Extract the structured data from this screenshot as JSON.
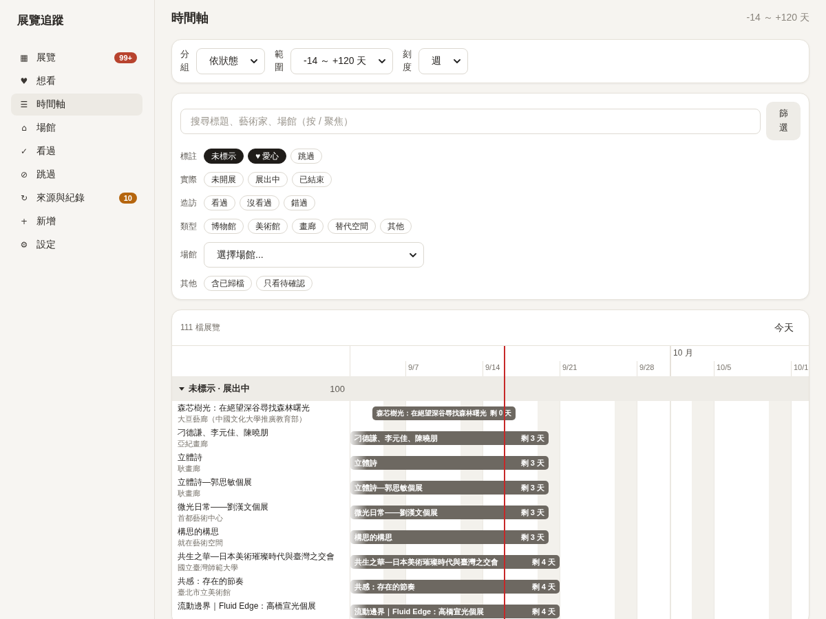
{
  "sidebar": {
    "title": "展覽追蹤",
    "items": [
      {
        "icon": "▦",
        "label": "展覽",
        "selected": false,
        "badge": {
          "text": "99+",
          "color": "#b8432e"
        }
      },
      {
        "icon": "♥",
        "label": "想看",
        "selected": false
      },
      {
        "icon": "☰",
        "label": "時間軸",
        "selected": true
      },
      {
        "icon": "⌂",
        "label": "場館",
        "selected": false
      },
      {
        "icon": "✓",
        "label": "看過",
        "selected": false
      },
      {
        "icon": "⊘",
        "label": "跳過",
        "selected": false
      },
      {
        "icon": "↻",
        "label": "來源與紀錄",
        "selected": false,
        "badge": {
          "text": "10",
          "color": "#b5650e"
        }
      },
      {
        "icon": "+",
        "label": "新增",
        "selected": false
      },
      {
        "icon": "⚙",
        "label": "設定",
        "selected": false
      }
    ]
  },
  "header": {
    "title": "時間軸",
    "range": "-14 ～ +120 天"
  },
  "view_controls": [
    {
      "label": "分組",
      "value": "依狀態"
    },
    {
      "label": "範圍",
      "value": "-14 ～ +120 天"
    },
    {
      "label": "刻度",
      "value": "週"
    }
  ],
  "filters": {
    "search": {
      "placeholder": "搜尋標題、藝術家、場館（按 / 聚焦）"
    },
    "filter_button": "篩選",
    "groups": [
      {
        "label": "標註",
        "kind": "chips",
        "chips": [
          {
            "label": "未標示",
            "selected": true
          },
          {
            "label": "♥ 愛心",
            "selected": true
          },
          {
            "label": "跳過",
            "selected": false
          }
        ]
      },
      {
        "label": "實際",
        "kind": "chips",
        "chips": [
          {
            "label": "未開展",
            "selected": false
          },
          {
            "label": "展出中",
            "selected": false
          },
          {
            "label": "已結束",
            "selected": false
          }
        ]
      },
      {
        "label": "造訪",
        "kind": "chips",
        "chips": [
          {
            "label": "看過",
            "selected": false
          },
          {
            "label": "沒看過",
            "selected": false
          },
          {
            "label": "錯過",
            "selected": false
          }
        ]
      },
      {
        "label": "類型",
        "kind": "chips",
        "chips": [
          {
            "label": "博物館",
            "selected": false
          },
          {
            "label": "美術館",
            "selected": false
          },
          {
            "label": "畫廊",
            "selected": false
          },
          {
            "label": "替代空間",
            "selected": false
          },
          {
            "label": "其他",
            "selected": false
          }
        ]
      },
      {
        "label": "場館",
        "kind": "select",
        "value": "選擇場館..."
      },
      {
        "label": "其他",
        "kind": "chips",
        "chips": [
          {
            "label": "含已歸檔",
            "selected": false
          },
          {
            "label": "只看待確認",
            "selected": false
          }
        ]
      }
    ]
  },
  "timeline": {
    "count": "111 檔展覽",
    "today_button": "今天",
    "month_labels": [
      "10 月"
    ],
    "week_labels": [
      "9/7",
      "9/14",
      "9/21",
      "9/28",
      "10/5",
      "10/1"
    ],
    "groups": [
      {
        "label": "未標示 · 展出中",
        "count": "100",
        "expanded": true,
        "rows": [
          {
            "title": "森芯樹光：在絕望深谷尋找森林曙光",
            "venue": "大亘藝廊（中國文化大學推廣教育部）",
            "bar_label": "森芯樹光：在絕望深谷尋找森林曙光",
            "days_left": "剩 0 天",
            "clipped_left": false
          },
          {
            "title": "刁德謙、李元佳、陳曉朋",
            "venue": "亞紀畫廊",
            "bar_label": "刁德謙、李元佳、陳曉朋",
            "days_left": "剩 3 天",
            "clipped_left": true
          },
          {
            "title": "立體詩",
            "venue": "耿畫廊",
            "bar_label": "立體詩",
            "days_left": "剩 3 天",
            "clipped_left": true
          },
          {
            "title": "立體詩—郭思敏個展",
            "venue": "耿畫廊",
            "bar_label": "立體詩—郭思敏個展",
            "days_left": "剩 3 天",
            "clipped_left": true
          },
          {
            "title": "微光日常——劉漢文個展",
            "venue": "首都藝術中心",
            "bar_label": "微光日常——劉漢文個展",
            "days_left": "剩 3 天",
            "clipped_left": true
          },
          {
            "title": "構思的構思",
            "venue": "就在藝術空間",
            "bar_label": "構思的構思",
            "days_left": "剩 3 天",
            "clipped_left": true
          },
          {
            "title": "共生之華—日本美術璀璨時代與臺灣之交會",
            "venue": "國立臺灣師範大學",
            "bar_label": "共生之華—日本美術璀璨時代與臺灣之交會",
            "days_left": "剩 4 天",
            "clipped_left": true
          },
          {
            "title": "共感：存在的節奏",
            "venue": "臺北市立美術館",
            "bar_label": "共感：存在的節奏",
            "days_left": "剩 4 天",
            "clipped_left": true
          },
          {
            "title": "流動邊界｜Fluid Edge：高橋宣光個展",
            "bar_label": "流動邊界｜Fluid Edge：高橋宣光個展",
            "days_left": "剩 4 天",
            "clipped_left": true
          }
        ]
      }
    ]
  }
}
